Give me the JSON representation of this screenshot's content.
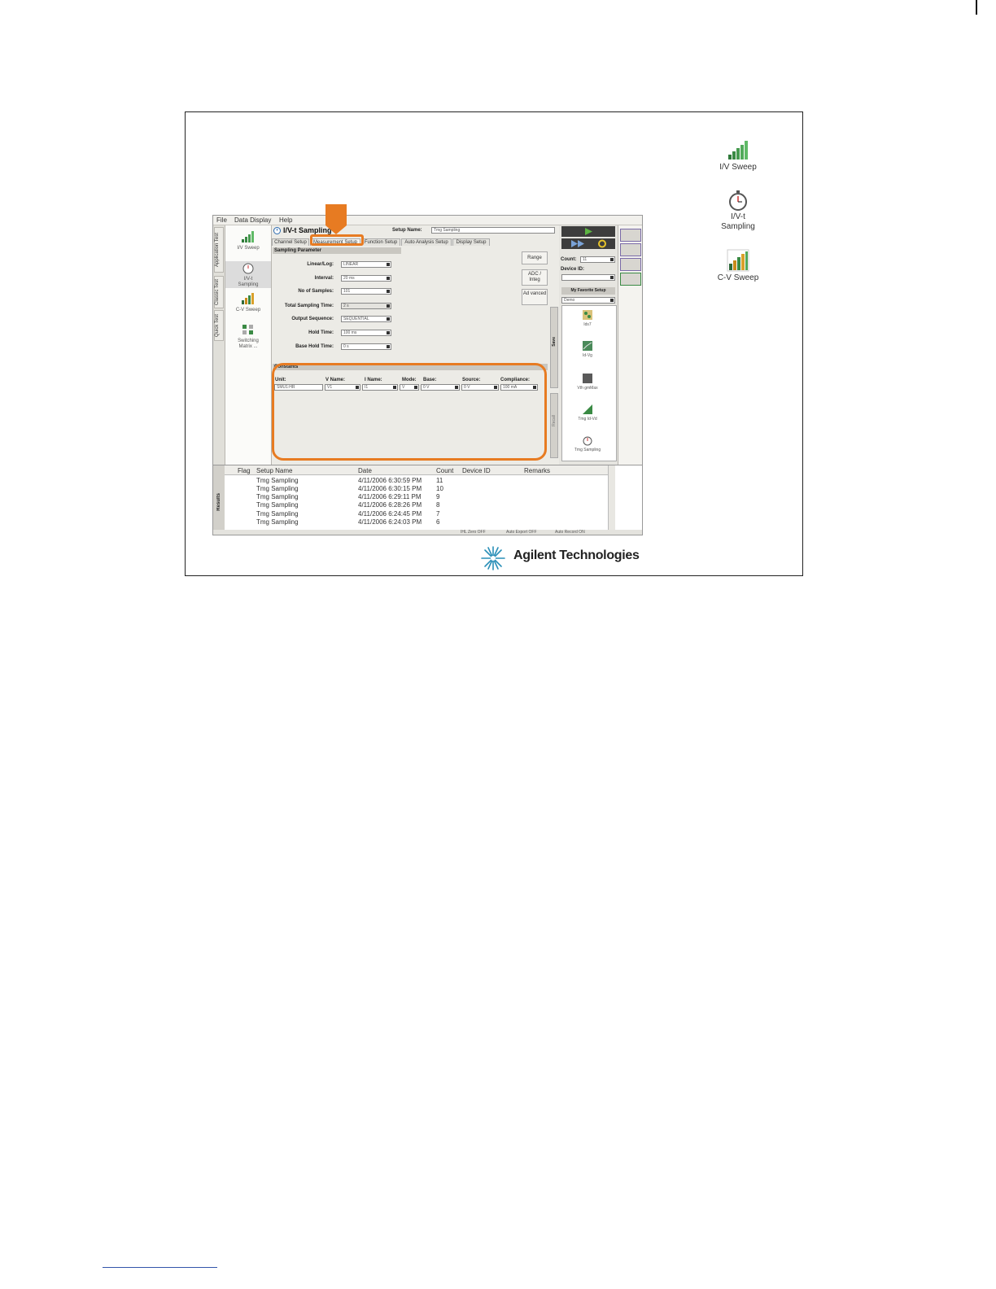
{
  "desktop_icons": [
    {
      "name": "iv-sweep",
      "label": "I/V Sweep"
    },
    {
      "name": "ivt-sampling",
      "label_line1": "I/V-t",
      "label_line2": "Sampling"
    },
    {
      "name": "cv-sweep",
      "label": "C-V Sweep"
    }
  ],
  "app": {
    "menu": [
      "File",
      "Data Display",
      "Help"
    ],
    "vertical_tabs": [
      "Application Test",
      "Classic Test",
      "Quick Test"
    ],
    "app_types": [
      {
        "label": "I/V Sweep"
      },
      {
        "label_line1": "I/V-t",
        "label_line2": "Sampling"
      },
      {
        "label": "C-V Sweep"
      },
      {
        "label_line1": "Switching",
        "label_line2": "Matrix ..."
      }
    ],
    "title": "I/V-t Sampling",
    "setup_name_label": "Setup Name:",
    "setup_name_value": "Tmg Sampling",
    "tabs": [
      "Channel Setup",
      "Measurement Setup",
      "Function Setup",
      "Auto Analysis Setup",
      "Display Setup"
    ],
    "sampling_section": "Sampling Parameter",
    "params": [
      {
        "label": "Linear/Log:",
        "value": "LINEAR",
        "dropdown": true
      },
      {
        "label": "Interval:",
        "value": "20 ms",
        "dropdown": false
      },
      {
        "label": "No of Samples:",
        "value": "101",
        "dropdown": false
      },
      {
        "label": "Total Sampling Time:",
        "value": "2 s",
        "dropdown": false
      },
      {
        "label": "Output Sequence:",
        "value": "SEQUENTIAL",
        "dropdown": true
      },
      {
        "label": "Hold Time:",
        "value": "100 ms",
        "dropdown": false
      },
      {
        "label": "Base Hold Time:",
        "value": "0 s",
        "dropdown": false
      }
    ],
    "side_buttons": [
      "Range",
      "ADC / Integ",
      "Ad vanced"
    ],
    "constants_section": "Constants",
    "constants_columns": [
      "Unit:",
      "V Name:",
      "I Name:",
      "Mode:",
      "Base:",
      "Source:",
      "Compliance:"
    ],
    "constants_row": [
      "SMU1:HR",
      "V1",
      "I1",
      "V",
      "0 V",
      "0 V",
      "100 mA"
    ],
    "count_label": "Count:",
    "count_value": "11",
    "device_id_label": "Device ID:",
    "favorite_setup": "My Favorite Setup",
    "favorite_dropdown": "Demo",
    "favorites": [
      "Ids7",
      "Id-Vg",
      "Vth gmMax",
      "Tmg Id-Vd",
      "Tmg Sampling"
    ],
    "save_label": "Save",
    "recall_label": "Recall",
    "results_tab": "Results",
    "results_columns": [
      "Flag",
      "Setup Name",
      "Date",
      "Count",
      "Device ID",
      "Remarks"
    ],
    "results_rows": [
      {
        "setup": "Tmg Sampling",
        "date": "4/11/2006 6:30:59 PM",
        "count": "11"
      },
      {
        "setup": "Tmg Sampling",
        "date": "4/11/2006 6:30:15 PM",
        "count": "10"
      },
      {
        "setup": "Tmg Sampling",
        "date": "4/11/2006 6:29:11 PM",
        "count": "9"
      },
      {
        "setup": "Tmg Sampling",
        "date": "4/11/2006 6:28:26 PM",
        "count": "8"
      },
      {
        "setup": "Tmg Sampling",
        "date": "4/11/2006 6:24:45 PM",
        "count": "7"
      },
      {
        "setup": "Tmg Sampling",
        "date": "4/11/2006 6:24:03 PM",
        "count": "6"
      }
    ],
    "status": [
      "IHL Zero OFF",
      "Auto Export OFF",
      "Auto Record ON"
    ]
  },
  "logo_text": "Agilent Technologies",
  "colors": {
    "highlight": "#e77b22",
    "run_green": "#5db543",
    "dark_bar": "#3d3d3d"
  }
}
